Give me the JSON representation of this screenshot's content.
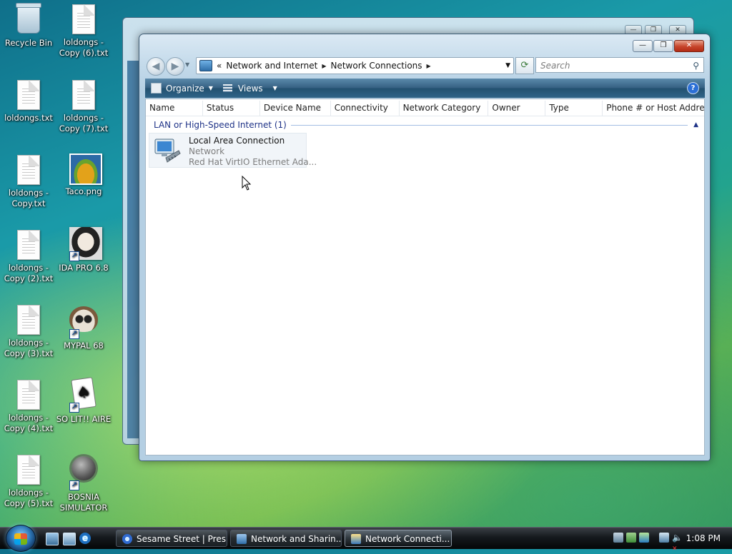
{
  "desktop": {
    "icons": [
      {
        "label": "Recycle Bin"
      },
      {
        "label": "loldongs - Copy (6).txt"
      },
      {
        "label": "loldongs.txt"
      },
      {
        "label": "loldongs - Copy (7).txt"
      },
      {
        "label": "loldongs - Copy.txt"
      },
      {
        "label": "Taco.png"
      },
      {
        "label": "loldongs - Copy (2).txt"
      },
      {
        "label": "IDA PRO 6.8"
      },
      {
        "label": "loldongs - Copy (3).txt"
      },
      {
        "label": "MYPAL 68"
      },
      {
        "label": "loldongs - Copy (4).txt"
      },
      {
        "label": "SO LIT!! AIRE"
      },
      {
        "label": "loldongs - Copy (5).txt"
      },
      {
        "label": "BOSNIA SIMULATOR"
      }
    ]
  },
  "window": {
    "address": {
      "overflow": "«",
      "crumbs": [
        "Network and Internet",
        "Network Connections"
      ]
    },
    "search": {
      "placeholder": "Search"
    },
    "toolbar": {
      "organize": "Organize",
      "views": "Views",
      "help": "?"
    },
    "columns": [
      "Name",
      "Status",
      "Device Name",
      "Connectivity",
      "Network Category",
      "Owner",
      "Type",
      "Phone # or Host Addre..."
    ],
    "group": {
      "label": "LAN or High-Speed Internet (1)"
    },
    "item": {
      "name": "Local Area Connection",
      "status": "Network",
      "device": "Red Hat VirtIO Ethernet Ada..."
    }
  },
  "taskbar": {
    "buttons": [
      {
        "label": "Sesame Street | Pres..."
      },
      {
        "label": "Network and Sharin..."
      },
      {
        "label": "Network Connecti..."
      }
    ],
    "clock": "1:08 PM"
  }
}
